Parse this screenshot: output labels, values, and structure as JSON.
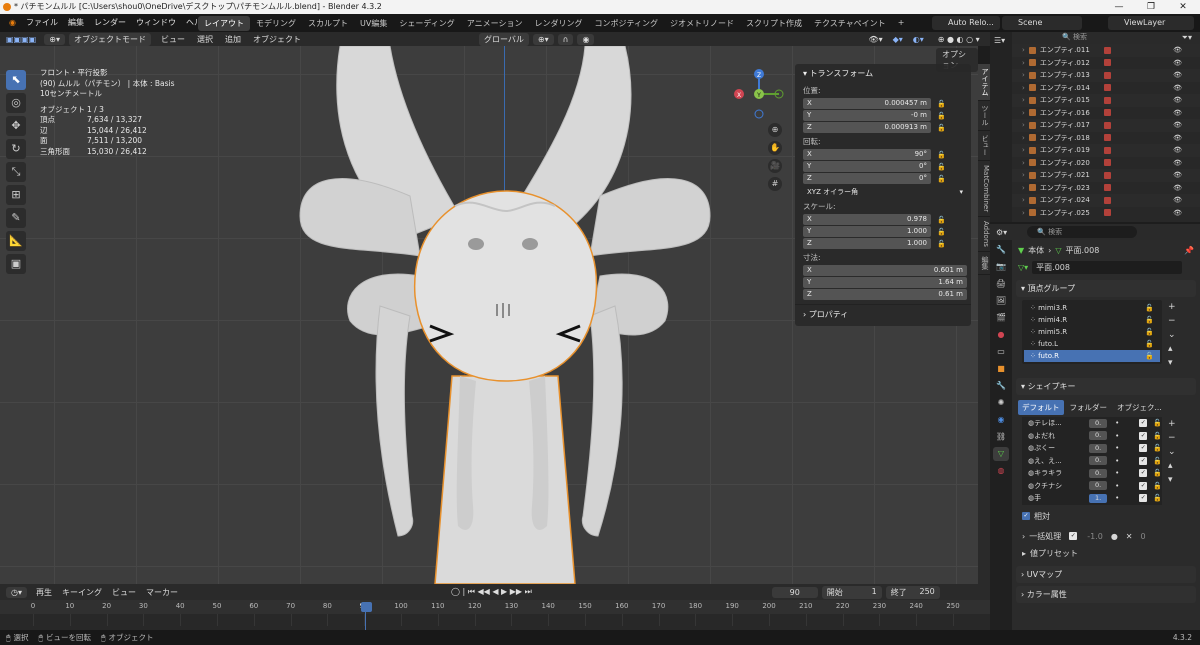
{
  "window": {
    "title": "* パチモンムルル [C:\\Users\\shou0\\OneDrive\\デスクトップ\\パチモンムルル.blend] - Blender 4.3.2",
    "minimize": "—",
    "maximize": "❐",
    "close": "✕"
  },
  "menu": [
    "ファイル",
    "編集",
    "レンダー",
    "ウィンドウ",
    "ヘルプ"
  ],
  "workspaces": [
    "レイアウト",
    "モデリング",
    "スカルプト",
    "UV編集",
    "シェーディング",
    "アニメーション",
    "レンダリング",
    "コンポジティング",
    "ジオメトリノード",
    "スクリプト作成",
    "テクスチャペイント",
    "+"
  ],
  "active_workspace": "レイアウト",
  "topright": {
    "auto_reload": "Auto Relo...",
    "scene": "Scene",
    "view_layer": "ViewLayer"
  },
  "viewport_header": {
    "mode": "オブジェクトモード",
    "menus": [
      "ビュー",
      "選択",
      "追加",
      "オブジェクト"
    ],
    "orientation": "グローバル",
    "options": "オプション"
  },
  "info": {
    "view": "フロント・平行投影",
    "object": "(90) ムルル（パチモン） | 本体 : Basis",
    "scale": "10センチメートル",
    "stats": [
      {
        "label": "オブジェクト",
        "value": "1 / 3"
      },
      {
        "label": "頂点",
        "value": "7,634 / 13,327"
      },
      {
        "label": "辺",
        "value": "15,044 / 26,412"
      },
      {
        "label": "面",
        "value": "7,511 / 13,200"
      },
      {
        "label": "三角形面",
        "value": "15,030 / 26,412"
      }
    ]
  },
  "gizmo": {
    "x": "X",
    "y": "Y",
    "z": "Z"
  },
  "npanel": {
    "transform": "トランスフォーム",
    "location": "位置:",
    "loc": [
      {
        "axis": "X",
        "value": "0.000457 m"
      },
      {
        "axis": "Y",
        "value": "-0 m"
      },
      {
        "axis": "Z",
        "value": "0.000913 m"
      }
    ],
    "rotation": "回転:",
    "rot": [
      {
        "axis": "X",
        "value": "90°"
      },
      {
        "axis": "Y",
        "value": "0°"
      },
      {
        "axis": "Z",
        "value": "0°"
      }
    ],
    "euler": "XYZ オイラー角",
    "scale": "スケール:",
    "scl": [
      {
        "axis": "X",
        "value": "0.978"
      },
      {
        "axis": "Y",
        "value": "1.000"
      },
      {
        "axis": "Z",
        "value": "1.000"
      }
    ],
    "dimensions": "寸法:",
    "dim": [
      {
        "axis": "X",
        "value": "0.601 m"
      },
      {
        "axis": "Y",
        "value": "1.64 m"
      },
      {
        "axis": "Z",
        "value": "0.61 m"
      }
    ],
    "properties": "プロパティ"
  },
  "side_tabs": [
    "アイテム",
    "ツール",
    "ビュー",
    "MatCombiner",
    "Addons",
    "編集"
  ],
  "timeline": {
    "menus": [
      "再生",
      "キーイング",
      "ビュー",
      "マーカー"
    ],
    "current_frame": "90",
    "start_label": "開始",
    "start": "1",
    "end_label": "終了",
    "end": "250",
    "ticks": [
      "0",
      "10",
      "20",
      "30",
      "40",
      "50",
      "60",
      "70",
      "80",
      "90",
      "100",
      "110",
      "120",
      "130",
      "140",
      "150",
      "160",
      "170",
      "180",
      "190",
      "200",
      "210",
      "220",
      "230",
      "240",
      "250"
    ]
  },
  "status": {
    "select": "選択",
    "rotate": "ビューを回転",
    "object": "オブジェクト",
    "version": "4.3.2"
  },
  "outliner": {
    "items": [
      "エンプティ.011",
      "エンプティ.012",
      "エンプティ.013",
      "エンプティ.014",
      "エンプティ.015",
      "エンプティ.016",
      "エンプティ.017",
      "エンプティ.018",
      "エンプティ.019",
      "エンプティ.020",
      "エンプティ.021",
      "エンプティ.023",
      "エンプティ.024",
      "エンプティ.025"
    ]
  },
  "properties": {
    "search": "検索",
    "breadcrumb_obj": "本体",
    "breadcrumb_mesh": "平面.008",
    "mesh_name": "平面.008",
    "vertex_groups_title": "頂点グループ",
    "vertex_groups": [
      "mimi3.R",
      "mimi4.R",
      "mimi5.R",
      "futo.L",
      "futo.R"
    ],
    "shape_keys_title": "シェイプキー",
    "sk_buttons": [
      "デフォルト",
      "フォルダー",
      "オブジェク..."
    ],
    "shape_keys": [
      {
        "name": "テレほ...",
        "value": "0."
      },
      {
        "name": "よだれ",
        "value": "0."
      },
      {
        "name": "ぷくー",
        "value": "0."
      },
      {
        "name": "え、え...",
        "value": "0."
      },
      {
        "name": "キラキラ",
        "value": "0."
      },
      {
        "name": "クチナシ",
        "value": "0."
      },
      {
        "name": "手",
        "value": "1."
      }
    ],
    "relative": "相対",
    "batch": "一括処理",
    "batch_value": "-1.0",
    "batch_num": "0",
    "value_preset": "値プリセット",
    "uv_maps": "UVマップ",
    "color_attr": "カラー属性"
  }
}
